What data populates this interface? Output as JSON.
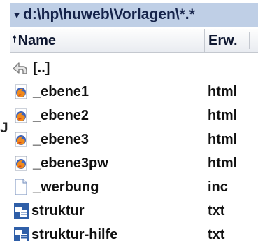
{
  "outside_glyph": "J",
  "path": {
    "arrow_icon": "triangle-down-icon",
    "text": "d:\\hp\\huweb\\Vorlagen\\*.*"
  },
  "columns": {
    "name": "Name",
    "ext": "Erw.",
    "sort_icon": "arrow-up-icon"
  },
  "files": [
    {
      "name": "[..]",
      "ext": "",
      "icon": "parent-folder-icon"
    },
    {
      "name": "_ebene1",
      "ext": "html",
      "icon": "firefox-icon"
    },
    {
      "name": "_ebene2",
      "ext": "html",
      "icon": "firefox-icon"
    },
    {
      "name": "_ebene3",
      "ext": "html",
      "icon": "firefox-icon"
    },
    {
      "name": "_ebene3pw",
      "ext": "html",
      "icon": "firefox-icon"
    },
    {
      "name": "_werbung",
      "ext": "inc",
      "icon": "blank-document-icon"
    },
    {
      "name": "struktur",
      "ext": "txt",
      "icon": "text-file-icon"
    },
    {
      "name": "struktur-hilfe",
      "ext": "txt",
      "icon": "text-file-icon"
    }
  ]
}
